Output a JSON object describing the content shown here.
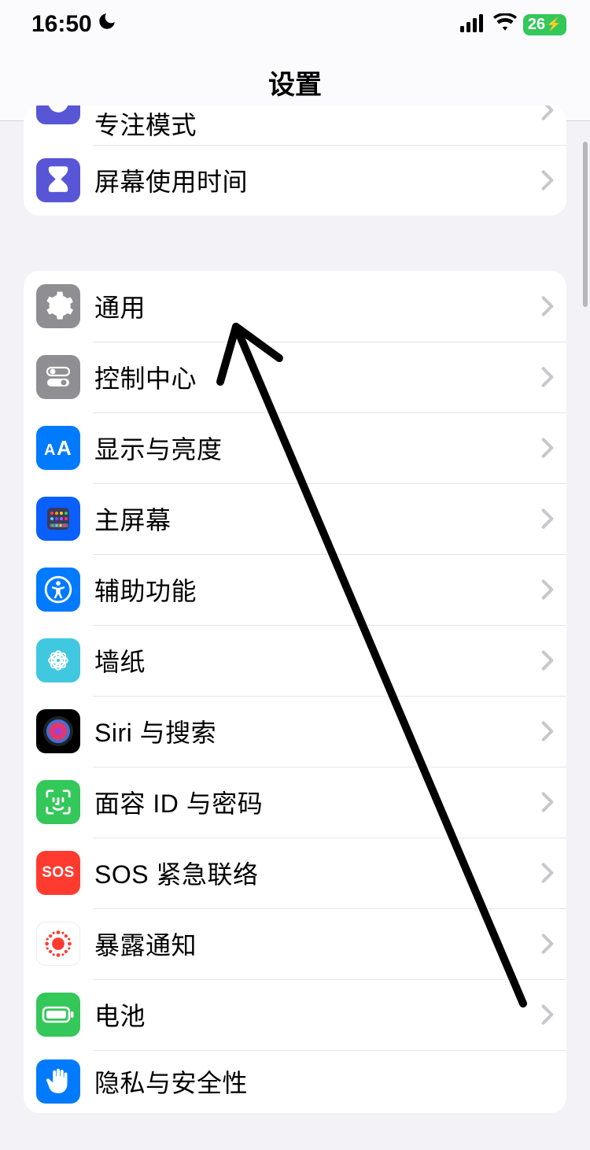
{
  "status": {
    "time": "16:50",
    "battery_pct": "26"
  },
  "header": {
    "title": "设置"
  },
  "group1": {
    "rows": [
      {
        "label": "专注模式"
      },
      {
        "label": "屏幕使用时间"
      }
    ]
  },
  "group2": {
    "rows": [
      {
        "label": "通用"
      },
      {
        "label": "控制中心"
      },
      {
        "label": "显示与亮度"
      },
      {
        "label": "主屏幕"
      },
      {
        "label": "辅助功能"
      },
      {
        "label": "墙纸"
      },
      {
        "label": "Siri 与搜索"
      },
      {
        "label": "面容 ID 与密码"
      },
      {
        "label": "SOS 紧急联络"
      },
      {
        "label": "暴露通知"
      },
      {
        "label": "电池"
      },
      {
        "label": "隐私与安全性"
      }
    ]
  },
  "sos_text": "SOS"
}
